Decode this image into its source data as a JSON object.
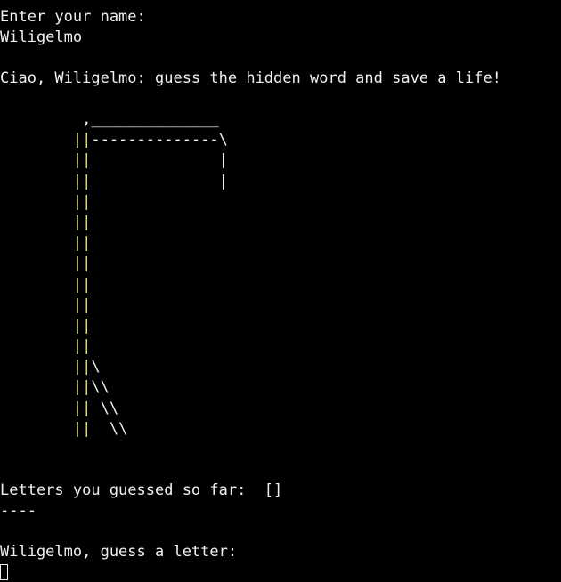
{
  "terminal": {
    "prompt_name": "Enter your name:",
    "name_input": "Wiligelmo",
    "greeting": "Ciao, Wiligelmo: guess the hidden word and save a life!",
    "gallows_lines": [
      "         ,______________",
      "        ||--------------\\",
      "        ||              |",
      "        ||              |",
      "        ||",
      "        ||",
      "        ||",
      "        ||",
      "        ||",
      "        ||",
      "        ||",
      "        ||",
      "        ||\\",
      "        ||\\\\",
      "        || \\\\",
      "        ||  \\\\"
    ],
    "guessed_label": "Letters you guessed so far:  []",
    "word_mask": "----",
    "letter_prompt": "Wiligelmo, guess a letter:",
    "colors": {
      "background": "#000000",
      "text": "#f0f0f0",
      "pole": "#e8e07a"
    }
  }
}
